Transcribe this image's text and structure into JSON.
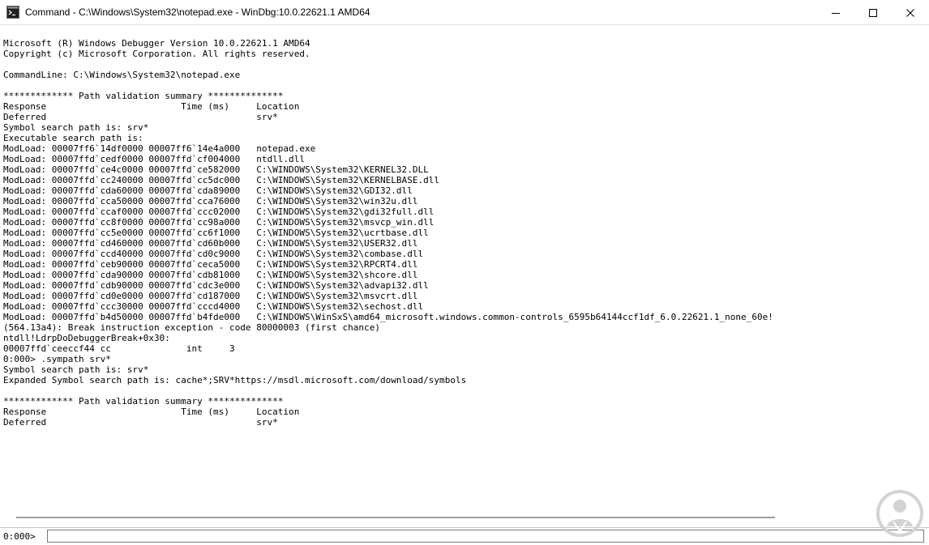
{
  "window": {
    "title": "Command - C:\\Windows\\System32\\notepad.exe - WinDbg:10.0.22621.1 AMD64",
    "app_icon": "console-icon",
    "controls": [
      "minimize-icon",
      "maximize-icon",
      "close-icon"
    ]
  },
  "output": {
    "lines": [
      "Microsoft (R) Windows Debugger Version 10.0.22621.1 AMD64",
      "Copyright (c) Microsoft Corporation. All rights reserved.",
      "",
      "CommandLine: C:\\Windows\\System32\\notepad.exe",
      "",
      "************* Path validation summary **************",
      "Response                         Time (ms)     Location",
      "Deferred                                       srv*",
      "Symbol search path is: srv*",
      "Executable search path is:",
      "ModLoad: 00007ff6`14df0000 00007ff6`14e4a000   notepad.exe",
      "ModLoad: 00007ffd`cedf0000 00007ffd`cf004000   ntdll.dll",
      "ModLoad: 00007ffd`ce4c0000 00007ffd`ce582000   C:\\WINDOWS\\System32\\KERNEL32.DLL",
      "ModLoad: 00007ffd`cc240000 00007ffd`cc5dc000   C:\\WINDOWS\\System32\\KERNELBASE.dll",
      "ModLoad: 00007ffd`cda60000 00007ffd`cda89000   C:\\WINDOWS\\System32\\GDI32.dll",
      "ModLoad: 00007ffd`cca50000 00007ffd`cca76000   C:\\WINDOWS\\System32\\win32u.dll",
      "ModLoad: 00007ffd`ccaf0000 00007ffd`ccc02000   C:\\WINDOWS\\System32\\gdi32full.dll",
      "ModLoad: 00007ffd`cc8f0000 00007ffd`cc98a000   C:\\WINDOWS\\System32\\msvcp_win.dll",
      "ModLoad: 00007ffd`cc5e0000 00007ffd`cc6f1000   C:\\WINDOWS\\System32\\ucrtbase.dll",
      "ModLoad: 00007ffd`cd460000 00007ffd`cd60b000   C:\\WINDOWS\\System32\\USER32.dll",
      "ModLoad: 00007ffd`ccd40000 00007ffd`cd0c9000   C:\\WINDOWS\\System32\\combase.dll",
      "ModLoad: 00007ffd`ceb90000 00007ffd`ceca5000   C:\\WINDOWS\\System32\\RPCRT4.dll",
      "ModLoad: 00007ffd`cda90000 00007ffd`cdb81000   C:\\WINDOWS\\System32\\shcore.dll",
      "ModLoad: 00007ffd`cdb90000 00007ffd`cdc3e000   C:\\WINDOWS\\System32\\advapi32.dll",
      "ModLoad: 00007ffd`cd0e0000 00007ffd`cd187000   C:\\WINDOWS\\System32\\msvcrt.dll",
      "ModLoad: 00007ffd`ccc30000 00007ffd`cccd4000   C:\\WINDOWS\\System32\\sechost.dll",
      "ModLoad: 00007ffd`b4d50000 00007ffd`b4fde000   C:\\WINDOWS\\WinSxS\\amd64_microsoft.windows.common-controls_6595b64144ccf1df_6.0.22621.1_none_60e!",
      "(564.13a4): Break instruction exception - code 80000003 (first chance)",
      "ntdll!LdrpDoDebuggerBreak+0x30:",
      "00007ffd`ceeccf44 cc              int     3",
      "0:000> .sympath srv*",
      "Symbol search path is: srv*",
      "Expanded Symbol search path is: cache*;SRV*https://msdl.microsoft.com/download/symbols",
      "",
      "************* Path validation summary **************",
      "Response                         Time (ms)     Location",
      "Deferred                                       srv*"
    ]
  },
  "command": {
    "prompt": "0:000>",
    "value": ""
  },
  "watermark": {
    "icon": "solvetic-logo-icon",
    "color": "#d0d0d0"
  }
}
